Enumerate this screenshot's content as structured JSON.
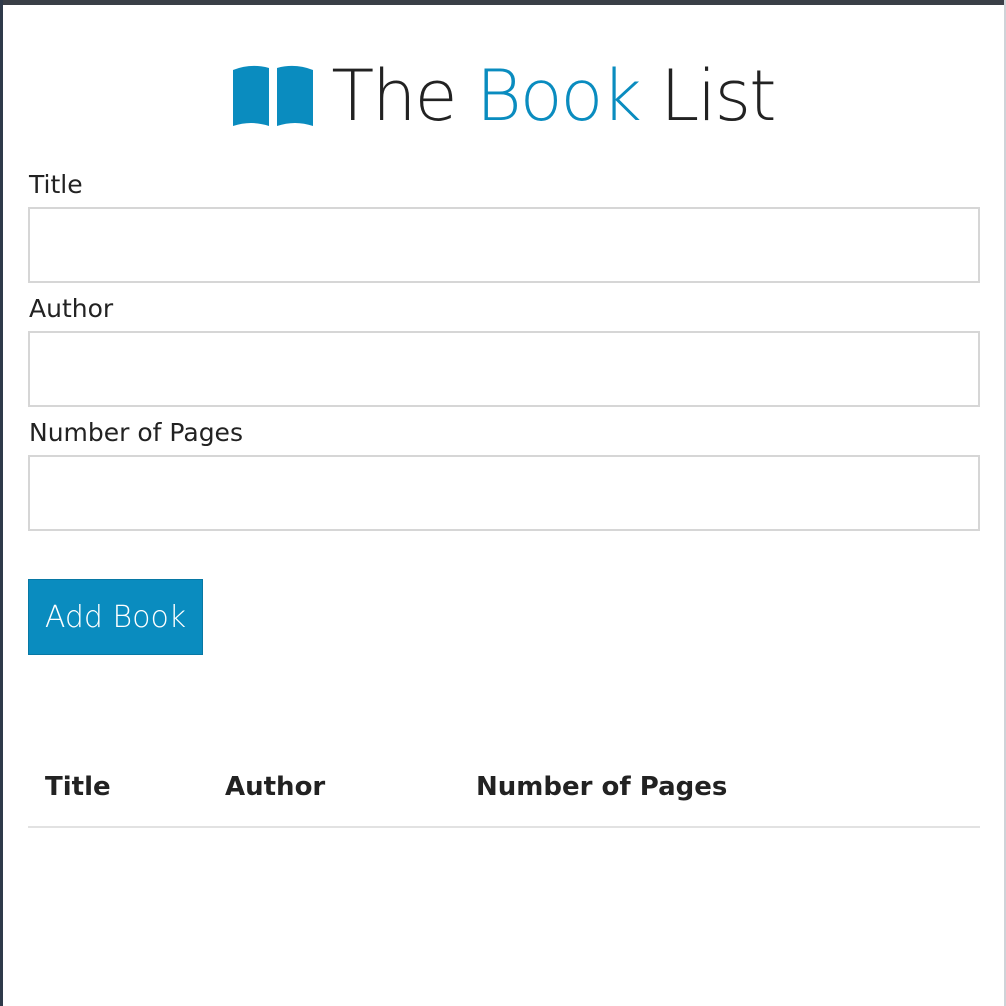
{
  "header": {
    "title_part1": "The",
    "title_accent": "Book",
    "title_part2": "List",
    "logo_icon": "open-book-icon",
    "accent_color": "#0a8cbf"
  },
  "form": {
    "title_label": "Title",
    "title_value": "",
    "author_label": "Author",
    "author_value": "",
    "pages_label": "Number of Pages",
    "pages_value": "",
    "submit_label": "Add Book"
  },
  "table": {
    "columns": [
      "Title",
      "Author",
      "Number of Pages"
    ],
    "rows": []
  }
}
